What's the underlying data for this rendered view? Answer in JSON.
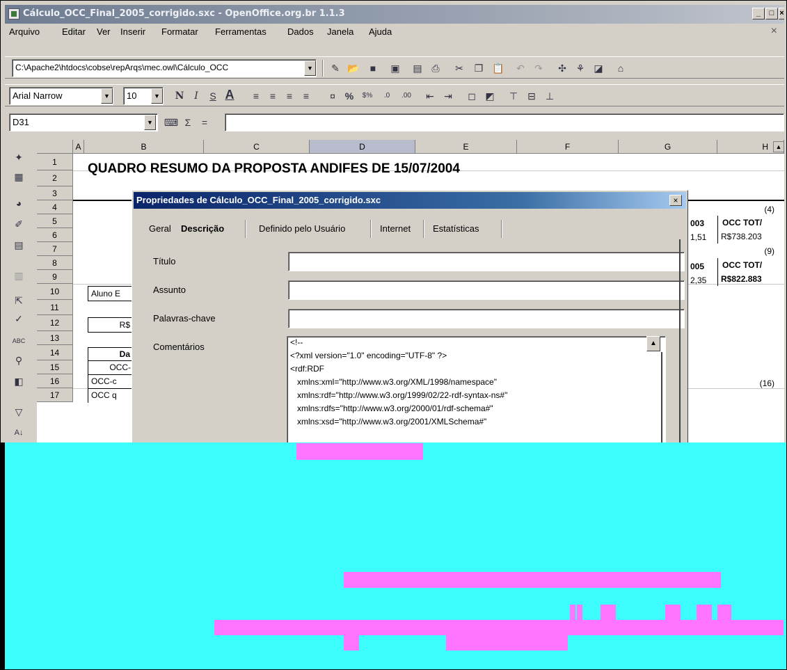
{
  "window": {
    "title": "Cálculo_OCC_Final_2005_corrigido.sxc - OpenOffice.org.br 1.1.3",
    "controls": [
      "_",
      "□",
      "×"
    ]
  },
  "menu": {
    "items": [
      "Arquivo",
      "Editar",
      "Ver",
      "Inserir",
      "Formatar",
      "Ferramentas",
      "Dados",
      "Janela",
      "Ajuda"
    ],
    "close": "×"
  },
  "toolbar": {
    "path": "C:\\Apache2\\htdocs\\cobse\\repArqs\\mec.owl\\Cálculo_OCC",
    "font_name": "Arial Narrow",
    "font_size": "10",
    "format_buttons": [
      "N",
      "I",
      "S",
      "A"
    ],
    "percent": "%"
  },
  "formula_bar": {
    "cell_ref": "D31",
    "sigma": "Σ",
    "equals": "="
  },
  "sheet": {
    "columns": [
      "A",
      "B",
      "C",
      "D",
      "E",
      "F",
      "G",
      "H"
    ],
    "selected_column": "D",
    "rows": [
      "1",
      "2",
      "3",
      "4",
      "5",
      "6",
      "7",
      "8",
      "9",
      "10",
      "11",
      "12",
      "13",
      "14",
      "15",
      "16",
      "17"
    ],
    "title": "QUADRO RESUMO DA PROPOSTA ANDIFES DE 15/07/2004",
    "cells": {
      "b10": "Aluno E",
      "b12": "R$",
      "b14": "Da",
      "b15": "OCC-",
      "b16": "OCC-c",
      "b17": "OCC q",
      "g4": "003",
      "h3": "(4)",
      "h4": "OCC TOT/",
      "g5": "1,51",
      "h5": "R$738.203",
      "h6": "(9)",
      "g7": "005",
      "h7": "OCC TOT/",
      "g8": "2,35",
      "h8": "R$822.883",
      "h16": "(16)"
    }
  },
  "dialog": {
    "title": "Propriedades de Cálculo_OCC_Final_2005_corrigido.sxc",
    "close": "×",
    "tabs": [
      "Geral",
      "Descrição",
      "Definido pelo Usuário",
      "Internet",
      "Estatísticas"
    ],
    "active_tab": "Descrição",
    "fields": {
      "titulo_label": "Título",
      "titulo_value": "",
      "assunto_label": "Assunto",
      "assunto_value": "",
      "palavras_label": "Palavras-chave",
      "palavras_value": "",
      "comentarios_label": "Comentários"
    },
    "comments_lines": [
      "<!--",
      "<?xml version=\"1.0\" encoding=\"UTF-8\" ?>",
      "<rdf:RDF",
      "   xmlns:xml=\"http://www.w3.org/XML/1998/namespace\"",
      "   xmlns:rdf=\"http://www.w3.org/1999/02/22-rdf-syntax-ns#\"",
      "   xmlns:rdfs=\"http://www.w3.org/2000/01/rdf-schema#\"",
      "   xmlns:xsd=\"http://www.w3.org/2001/XMLSchema#\""
    ]
  },
  "colors": {
    "cover": "#3dfcfc",
    "redaction": "#ff75ff",
    "dialog_title": "#0a246a"
  }
}
